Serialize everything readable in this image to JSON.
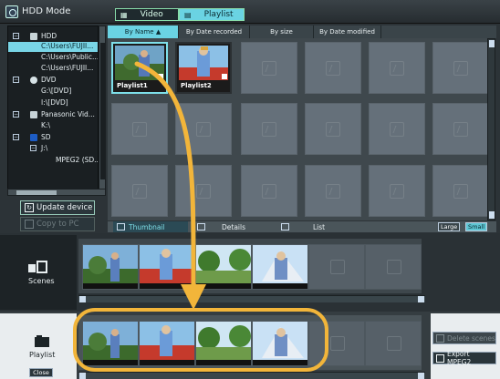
{
  "window": {
    "title": "HDD Mode"
  },
  "mode_tabs": [
    {
      "label": "Video",
      "active": false
    },
    {
      "label": "Playlist",
      "active": true
    }
  ],
  "tree": [
    {
      "label": "HDD",
      "level": 0,
      "expander": "⊟",
      "icon": "hdd-icon"
    },
    {
      "label": "C:\\Users\\FUJII...",
      "level": 2,
      "selected": true
    },
    {
      "label": "C:\\Users\\Public...",
      "level": 2
    },
    {
      "label": "C:\\Users\\FUJII...",
      "level": 2
    },
    {
      "label": "DVD",
      "level": 0,
      "expander": "⊟",
      "icon": "dvd-icon"
    },
    {
      "label": "G:\\[DVD]",
      "level": 2
    },
    {
      "label": "I:\\[DVD]",
      "level": 2
    },
    {
      "label": "Panasonic Vid...",
      "level": 0,
      "expander": "⊟",
      "icon": "camera-icon"
    },
    {
      "label": "K:\\",
      "level": 2
    },
    {
      "label": "SD",
      "level": 0,
      "expander": "⊟",
      "icon": "sd-card-icon"
    },
    {
      "label": "J:\\",
      "level": 1,
      "expander": "⊟"
    },
    {
      "label": "MPEG2 (SD...",
      "level": 3
    }
  ],
  "side_buttons": {
    "update_device": "Update device",
    "copy_to_pc": "Copy to PC"
  },
  "sort_tabs": [
    {
      "label": "By Name ▲",
      "active": true
    },
    {
      "label": "By Date recorded",
      "active": false
    },
    {
      "label": "By size",
      "active": false
    },
    {
      "label": "By Date modified",
      "active": false
    }
  ],
  "grid": {
    "items": [
      {
        "label": "Playlist1",
        "selected": true
      },
      {
        "label": "Playlist2",
        "selected": false
      }
    ]
  },
  "view_bar": {
    "thumbnail": "Thumbnail",
    "details": "Details",
    "list": "List",
    "large": "Large",
    "small": "Small"
  },
  "scenes": {
    "label": "Scenes"
  },
  "playlist": {
    "label": "Playlist",
    "close": "Close"
  },
  "right_buttons": {
    "delete_scenes": "Delete scenes",
    "export_mpeg2": "Export MPEG2"
  },
  "colors": {
    "accent": "#6ad3e3",
    "highlight_ring": "#f2b53a"
  }
}
